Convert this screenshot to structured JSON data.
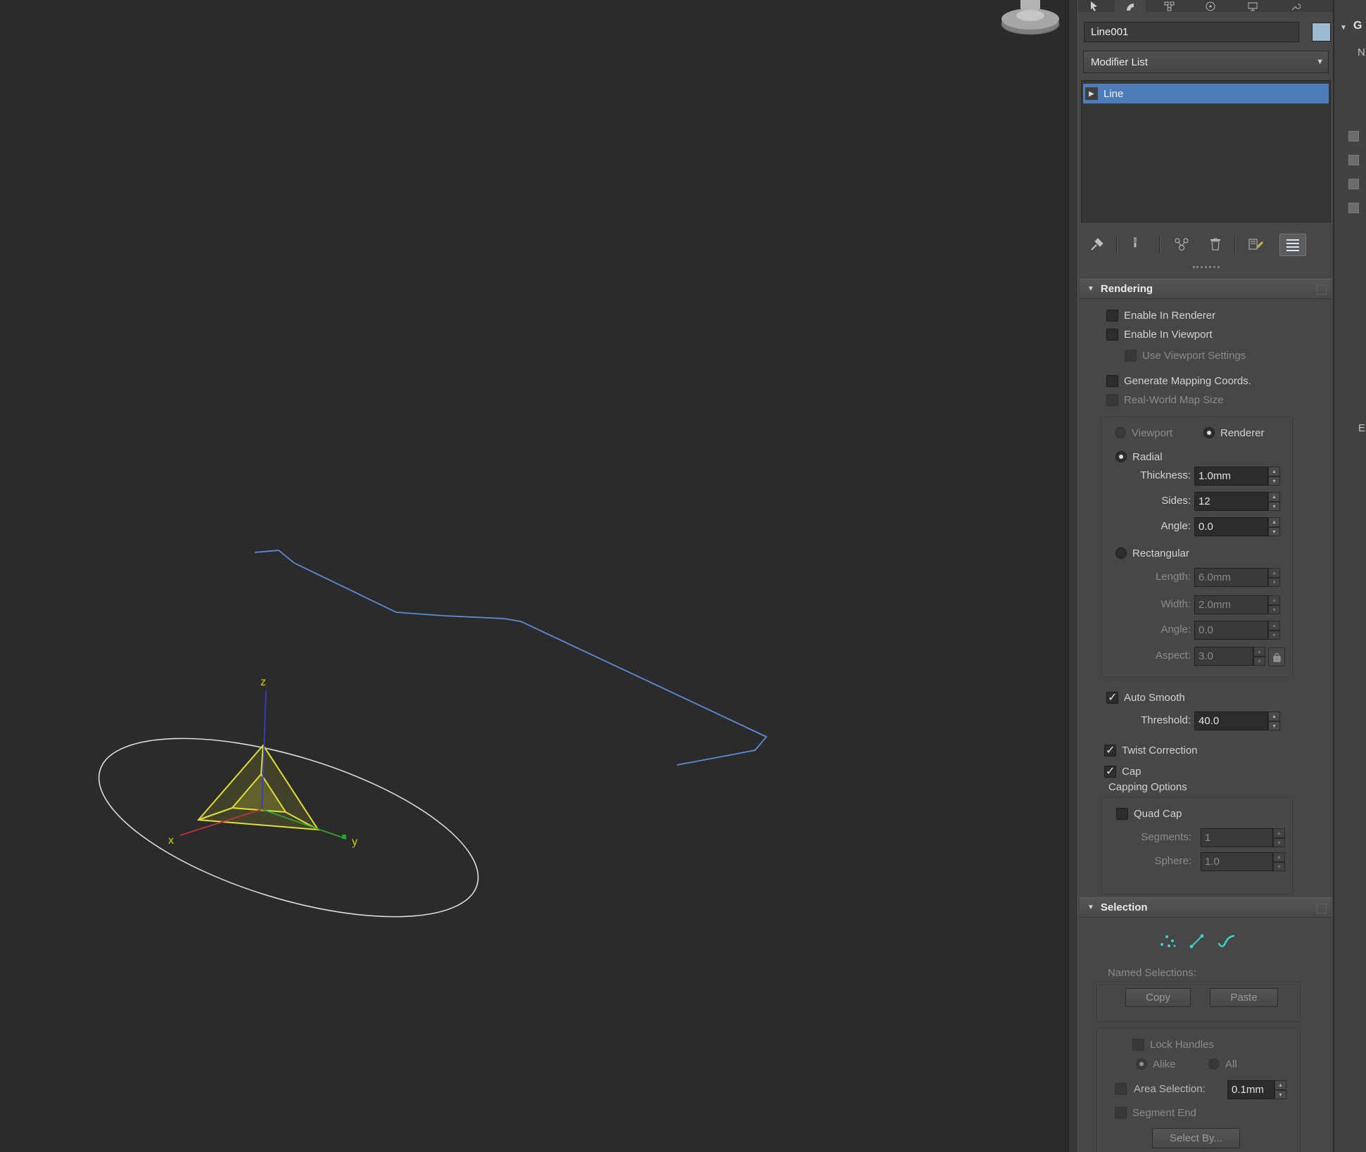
{
  "command_panel": {
    "object_name": "Line001",
    "modifier_list_label": "Modifier List",
    "modifier_stack": [
      {
        "label": "Line",
        "selected": true
      }
    ]
  },
  "rendering": {
    "title": "Rendering",
    "enable_in_renderer": "Enable In Renderer",
    "enable_in_viewport": "Enable In Viewport",
    "use_viewport_settings": "Use Viewport Settings",
    "generate_mapping": "Generate Mapping Coords.",
    "real_world_map": "Real-World Map Size",
    "viewport_label": "Viewport",
    "renderer_label": "Renderer",
    "radial_label": "Radial",
    "thickness_label": "Thickness:",
    "thickness_value": "1.0mm",
    "sides_label": "Sides:",
    "sides_value": "12",
    "angle_label": "Angle:",
    "angle_value": "0.0",
    "rectangular_label": "Rectangular",
    "length_label": "Length:",
    "length_value": "6.0mm",
    "width_label": "Width:",
    "width_value": "2.0mm",
    "angle2_label": "Angle:",
    "angle2_value": "0.0",
    "aspect_label": "Aspect:",
    "aspect_value": "3.0",
    "auto_smooth_label": "Auto Smooth",
    "threshold_label": "Threshold:",
    "threshold_value": "40.0",
    "twist_correction_label": "Twist Correction",
    "cap_label": "Cap",
    "capping_options_title": "Capping Options",
    "quad_cap_label": "Quad Cap",
    "segments_label": "Segments:",
    "segments_value": "1",
    "sphere_label": "Sphere:",
    "sphere_value": "1.0"
  },
  "selection": {
    "title": "Selection",
    "named_selections_label": "Named Selections:",
    "copy_label": "Copy",
    "paste_label": "Paste",
    "lock_handles_label": "Lock Handles",
    "alike_label": "Alike",
    "all_label": "All",
    "area_selection_label": "Area Selection:",
    "area_selection_value": "0.1mm",
    "segment_end_label": "Segment End",
    "select_by_label": "Select By..."
  },
  "viewport": {
    "axis_x": "x",
    "axis_y": "y",
    "axis_z": "z"
  },
  "right_strip": {
    "top_letter": "G",
    "second_letter": "N",
    "mid_letter": "E"
  },
  "colors": {
    "selection_highlight": "#4d7cba",
    "object_color_swatch": "#9cb9cf",
    "subobject_icon": "#38d6c9",
    "spline": "#5e8ad6",
    "axis_x": "#c23232",
    "axis_y": "#2fa32f",
    "axis_z": "#3b3bc8",
    "shape_outline": "#dcdcdc",
    "selected_shape": "#dede3a"
  },
  "states": {
    "checked": [
      "auto_smooth",
      "twist_correction",
      "cap"
    ],
    "radios_selected": [
      "renderer",
      "radial",
      "alike"
    ],
    "disabled_controls": [
      "use_viewport_settings",
      "real_world_map",
      "viewport_radio",
      "length",
      "width",
      "angle2",
      "aspect",
      "segments",
      "sphere",
      "named_selections",
      "copy",
      "paste",
      "lock_handles",
      "alike",
      "all",
      "segment_end",
      "select_by"
    ]
  }
}
